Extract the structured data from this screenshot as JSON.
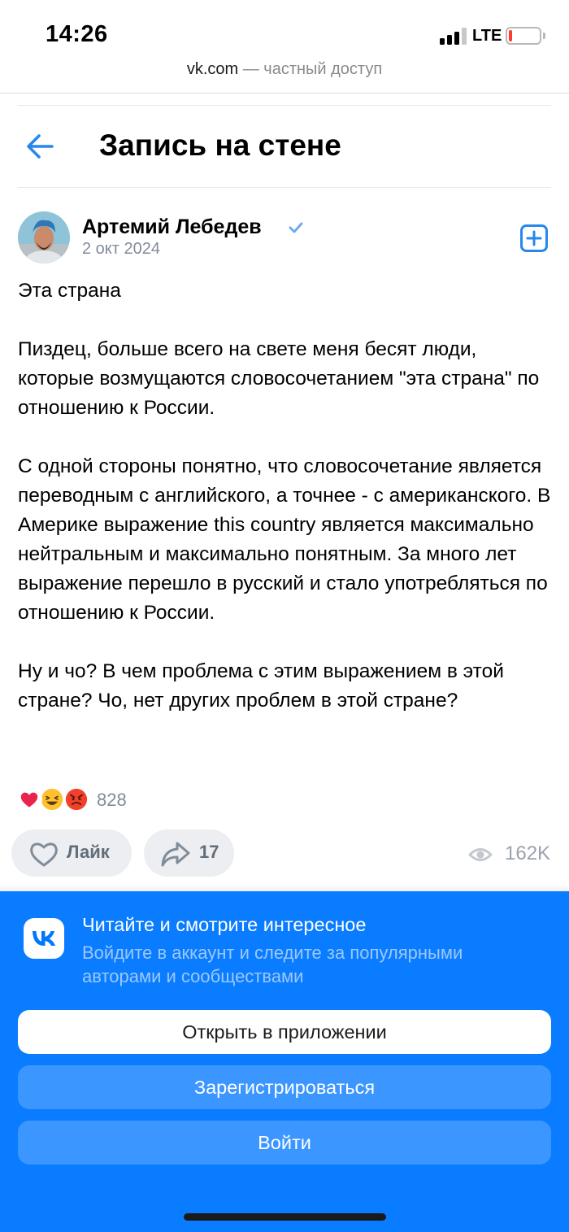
{
  "status_bar": {
    "time": "14:26",
    "network": "LTE",
    "signal_bars_filled": 3,
    "signal_bars_total": 4,
    "battery_level_fraction": 0.1,
    "battery_color": "#ff3b30"
  },
  "browser": {
    "host": "vk.com",
    "note": " — частный доступ"
  },
  "header": {
    "title": "Запись на стене",
    "back_icon": "arrow-left-icon"
  },
  "post": {
    "author": "Артемий Лебедев",
    "verified": true,
    "date": "2 окт 2024",
    "add_icon": "plus-square-icon",
    "paragraphs": [
      "Эта страна",
      "Пиздец, больше всего на свете меня бесят люди, которые возмущаются словосочетанием \"эта страна\" по отношению к России.",
      "С одной стороны понятно, что словосочетание является переводным с английского, а точнее - с американского. В Америке выражение this country является максимально нейтральным и максимально понятным. За много лет выражение перешло в русский и стало употребляться по отношению к России.",
      "Ну и чо? В чем проблема с этим выражением в этой стране? Чо, нет других проблем в этой стране?"
    ],
    "reactions": {
      "icons": [
        "heart-icon",
        "laughing-face-icon",
        "angry-face-icon"
      ],
      "count": "828"
    },
    "actions": {
      "like_label": "Лайк",
      "share_count": "17",
      "views_count": "162K"
    }
  },
  "promo": {
    "title": "Читайте и смотрите интересное",
    "subtitle": "Войдите в аккаунт и следите за популярными авторами и сообществами",
    "open_app_label": "Открыть в приложении",
    "register_label": "Зарегистрироваться",
    "login_label": "Войти",
    "brand_color": "#0a7cff"
  }
}
